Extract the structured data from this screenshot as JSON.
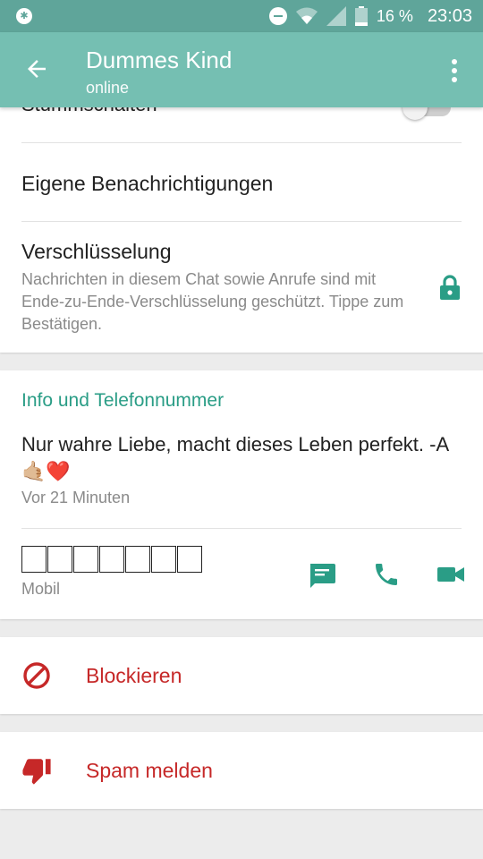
{
  "status_bar": {
    "battery": "16 %",
    "time": "23:03"
  },
  "appbar": {
    "title": "Dummes Kind",
    "subtitle": "online"
  },
  "settings": {
    "mute_label": "Stummschalten",
    "custom_notifications_label": "Eigene Benachrichtigungen",
    "encryption_label": "Verschlüsselung",
    "encryption_description": "Nachrichten in diesem Chat sowie Anrufe sind mit Ende-zu-Ende-Verschlüsselung geschützt. Tippe zum Bestätigen."
  },
  "info": {
    "section_title": "Info und Telefonnummer",
    "about_text": "Nur wahre Liebe, macht dieses Leben perfekt. -A",
    "about_emojis": "🤙🏼❤️",
    "about_time": "Vor 21 Minuten",
    "phone_type": "Mobil"
  },
  "actions": {
    "block_label": "Blockieren",
    "report_label": "Spam melden"
  },
  "colors": {
    "status_bar": "#5fa59a",
    "app_bar": "#75bfb2",
    "accent": "#2a9d86",
    "danger": "#c62828"
  }
}
